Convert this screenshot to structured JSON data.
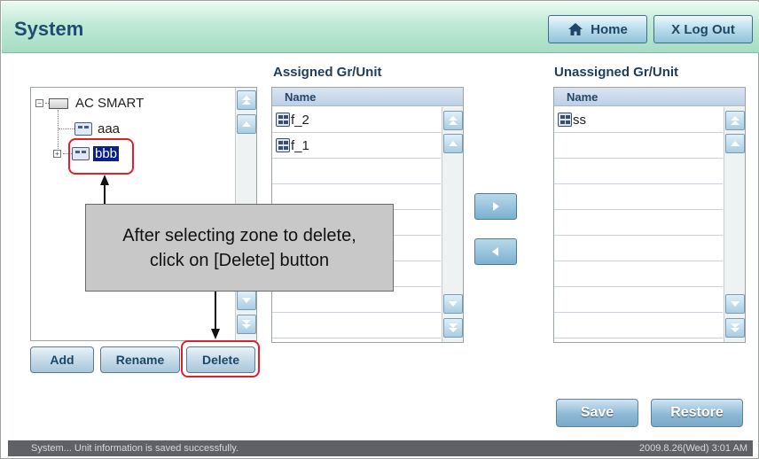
{
  "header": {
    "title": "System",
    "home_label": "Home",
    "logout_label": "X Log Out"
  },
  "tree": {
    "root_label": "AC SMART",
    "nodes": [
      {
        "label": "aaa",
        "selected": false
      },
      {
        "label": "bbb",
        "selected": true
      }
    ]
  },
  "tree_actions": {
    "add_label": "Add",
    "rename_label": "Rename",
    "delete_label": "Delete"
  },
  "assigned": {
    "title": "Assigned Gr/Unit",
    "column": "Name",
    "items": [
      "f_2",
      "f_1"
    ]
  },
  "unassigned": {
    "title": "Unassigned Gr/Unit",
    "column": "Name",
    "items": [
      "ss"
    ]
  },
  "footer_actions": {
    "save_label": "Save",
    "restore_label": "Restore"
  },
  "callout": {
    "line1": "After selecting zone to delete,",
    "line2": "click on [Delete] button"
  },
  "status": {
    "message": "System... Unit information is saved successfully.",
    "datetime": "2009.8.26(Wed)  3:01 AM"
  },
  "colors": {
    "accent_red": "#e0202a",
    "selection": "#0a1f8c",
    "header_green": "#a6dcc4",
    "title_blue": "#1f4b71"
  }
}
